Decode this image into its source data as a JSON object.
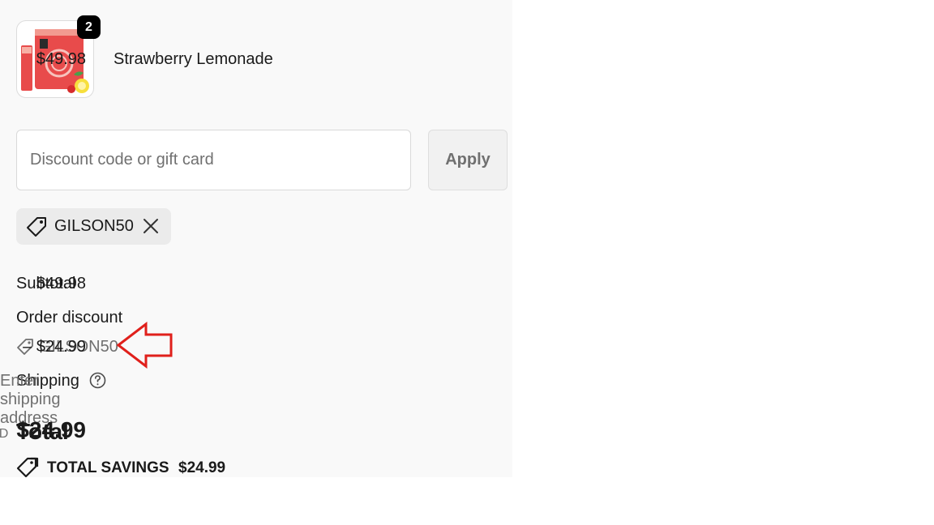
{
  "cart": {
    "items": [
      {
        "quantity": "2",
        "name": "Strawberry Lemonade",
        "price": "$49.98",
        "image_icon": "product-thumbnail"
      }
    ]
  },
  "discount": {
    "placeholder": "Discount code or gift card",
    "value": "",
    "apply_label": "Apply",
    "applied_chip": "GILSON50"
  },
  "summary": {
    "subtotal_label": "Subtotal",
    "subtotal_value": "$49.98",
    "order_discount_label": "Order discount",
    "order_discount_code": "GILSON50",
    "order_discount_value": "– $24.99",
    "shipping_label": "Shipping",
    "shipping_value": "Enter shipping address",
    "total_label": "Total",
    "currency": "USD",
    "total_value": "$24.99",
    "savings_label": "TOTAL SAVINGS",
    "savings_value": "$24.99"
  },
  "colors": {
    "panel_bg": "#f9f9f9",
    "annotation_arrow": "#e0201b",
    "badge_bg": "#000000",
    "chip_bg": "#ebebeb"
  }
}
